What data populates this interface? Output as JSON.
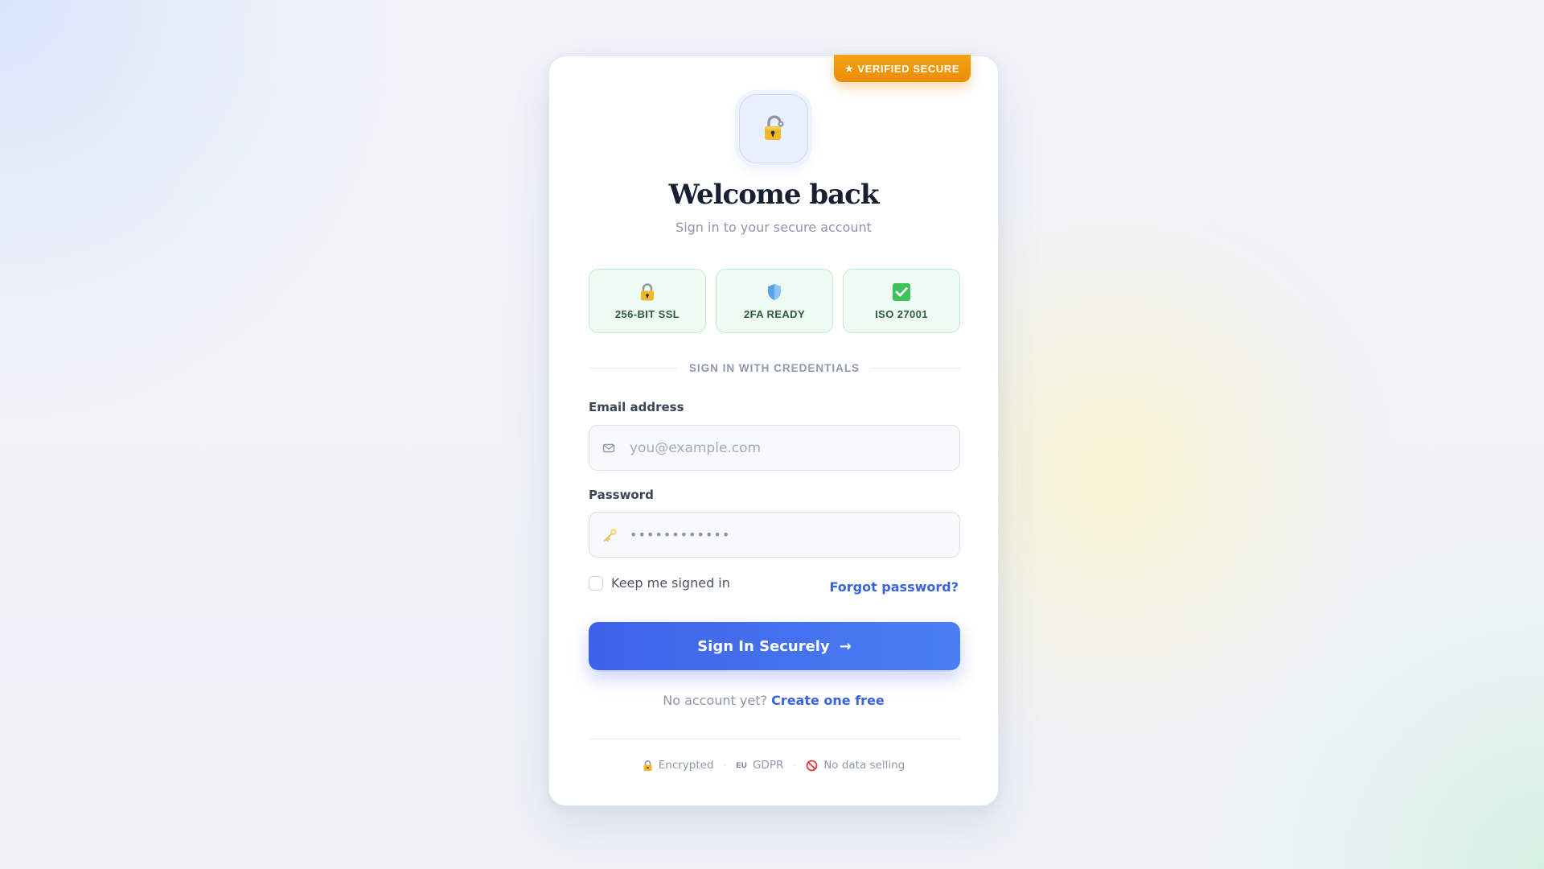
{
  "ribbon": {
    "star": "★",
    "label": "VERIFIED SECURE"
  },
  "header": {
    "logo_icon": "padlock-unlocked-icon",
    "title": "Welcome back",
    "subtitle": "Sign in to your secure account"
  },
  "badges": [
    {
      "icon": "padlock-icon",
      "label": "256-BIT SSL"
    },
    {
      "icon": "shield-icon",
      "label": "2FA READY"
    },
    {
      "icon": "check-box-icon",
      "label": "ISO 27001"
    }
  ],
  "divider": {
    "label": "SIGN IN WITH CREDENTIALS"
  },
  "form": {
    "email": {
      "label": "Email address",
      "placeholder": "you@example.com",
      "icon": "envelope-icon"
    },
    "password": {
      "label": "Password",
      "value": "••••••••••••",
      "icon": "key-icon"
    },
    "remember_label": "Keep me signed in",
    "forgot_label": "Forgot password?",
    "submit_label": "Sign In Securely",
    "submit_arrow": "→"
  },
  "signup": {
    "prompt": "No account yet?",
    "link": "Create one free"
  },
  "footer": {
    "encrypted": "Encrypted",
    "eu_badge": "EU",
    "gdpr": "GDPR",
    "no_selling": "No data selling",
    "separator": "·"
  },
  "colors": {
    "accent": "#3d62ea",
    "ribbon": "#ef9609",
    "badge_bg": "#effcf3",
    "badge_border": "#bdecca",
    "link": "#3a63e0"
  }
}
